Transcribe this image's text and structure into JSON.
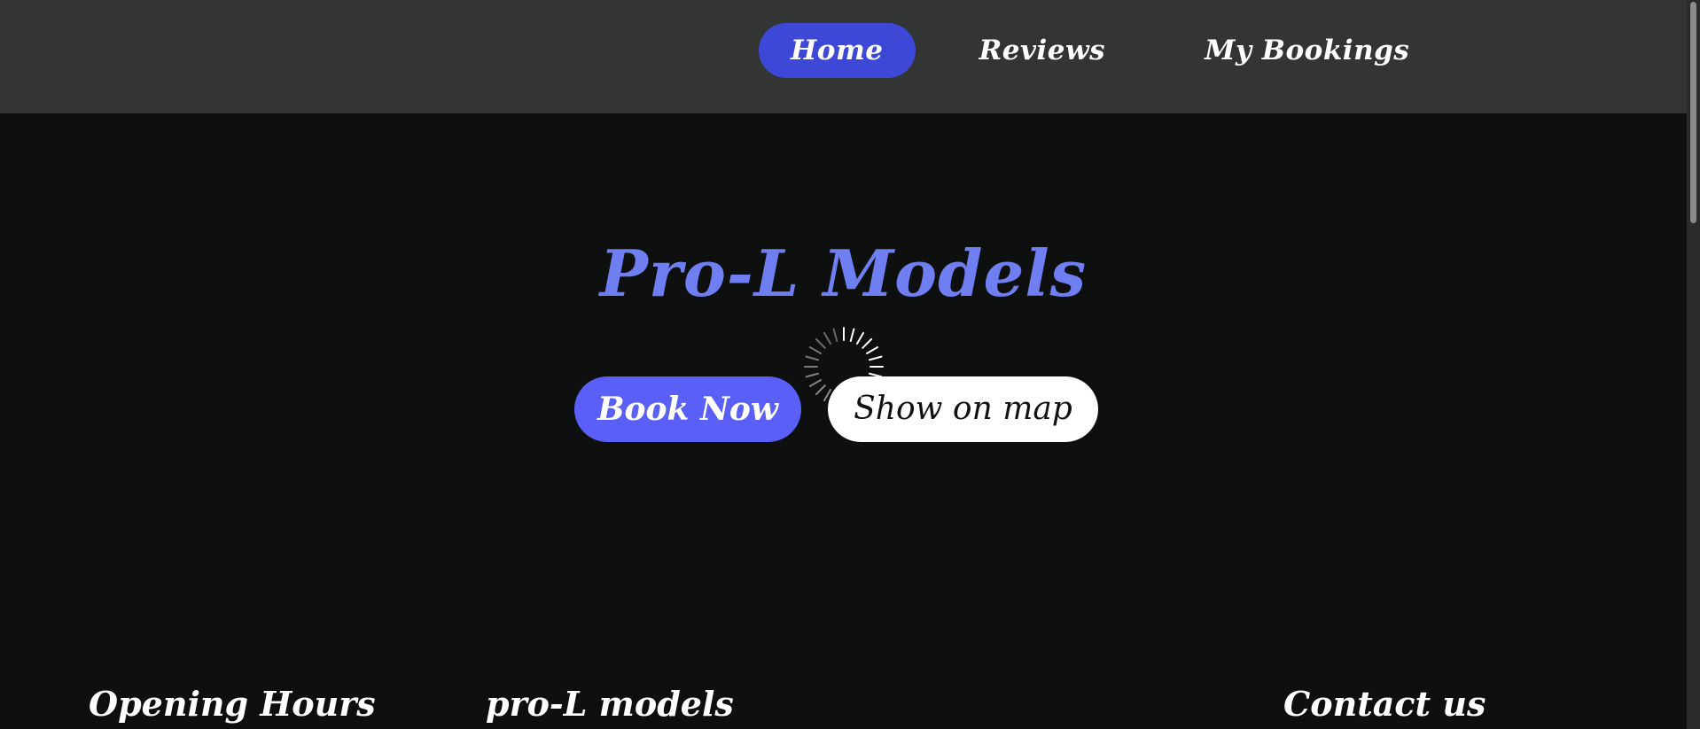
{
  "nav": {
    "items": [
      {
        "label": "Home",
        "active": true
      },
      {
        "label": "Reviews",
        "active": false
      },
      {
        "label": "My Bookings",
        "active": false
      }
    ]
  },
  "hero": {
    "title": "Pro-L Models",
    "book_label": "Book Now",
    "map_label": "Show on map"
  },
  "loading": {
    "icon": "loading-spinner-icon"
  },
  "footer": {
    "opening_hours_title": "Opening Hours",
    "brand_title": "pro-L models",
    "contact_title": "Contact us"
  },
  "colors": {
    "topbar_bg": "#333434",
    "page_bg": "#0e100f",
    "active_nav": "#3d48d6",
    "accent_title": "#6f7ef0",
    "book_button": "#5a5ff7"
  }
}
